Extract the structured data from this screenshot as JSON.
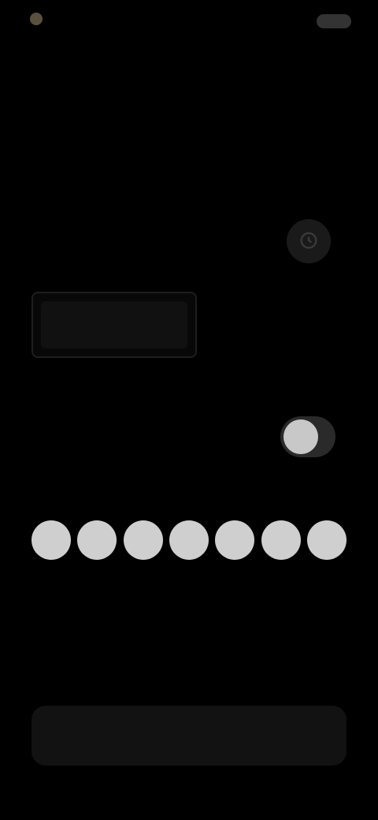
{
  "status": {
    "time": "",
    "right_text": ""
  },
  "nav": {
    "title": ""
  },
  "section": {
    "header": ""
  },
  "labels": {
    "time_label": "",
    "repeat_label": "",
    "days_label": ""
  },
  "time": {
    "value": ""
  },
  "options": {
    "selected": "",
    "alternative": ""
  },
  "toggle": {
    "label": "",
    "on": true
  },
  "days": [
    "",
    "",
    "",
    "",
    "",
    "",
    ""
  ],
  "save": {
    "label": ""
  },
  "colors": {
    "background": "#000000",
    "knob": "#c8c8c8",
    "day_circle": "#cfcfcf"
  },
  "icons": {
    "time_button": "clock-icon"
  }
}
